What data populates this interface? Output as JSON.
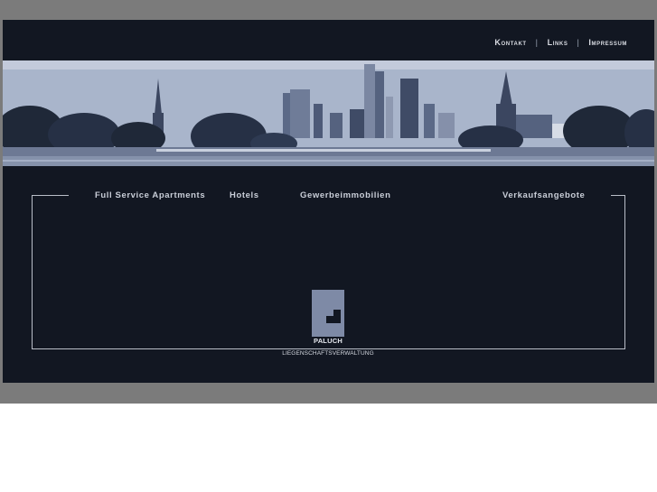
{
  "top_nav": {
    "items": [
      {
        "label": "Kontakt"
      },
      {
        "label": "Links"
      },
      {
        "label": "Impressum"
      }
    ],
    "separator": "|"
  },
  "main_nav": {
    "items": [
      {
        "label": "Full Service Apartments"
      },
      {
        "label": "Hotels"
      },
      {
        "label": "Gewerbeimmobilien"
      },
      {
        "label": "Verkaufsangebote"
      }
    ]
  },
  "logo": {
    "name": "PALUCH",
    "subtitle": "LIEGENSCHAFTSVERWALTUNG"
  },
  "colors": {
    "page_background": "#121722",
    "outer_frame": "#7b7b7b",
    "accent": "#7e8aa6",
    "text": "#c9ced8"
  }
}
